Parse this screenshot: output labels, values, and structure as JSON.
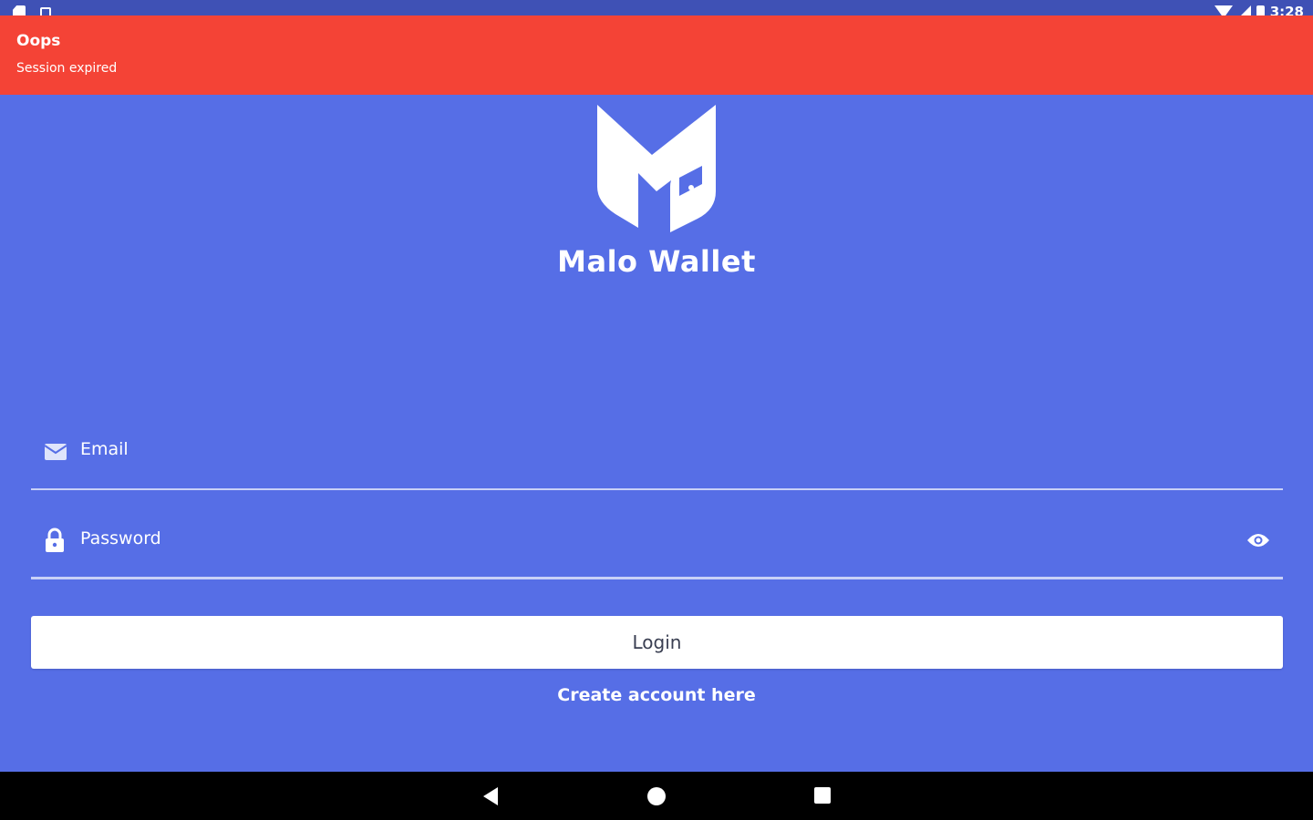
{
  "status_bar": {
    "time": "3:28",
    "left_icons": [
      "sd-card-icon",
      "notification-square-icon"
    ],
    "right_icons": [
      "wifi-icon",
      "cell-signal-icon",
      "battery-icon"
    ]
  },
  "snackbar": {
    "title": "Oops",
    "message": "Session expired",
    "color": "#f44336"
  },
  "brand": {
    "app_name": "Malo Wallet",
    "logo_icon": "malo-wallet-logo-icon",
    "background_color": "#566ee6"
  },
  "login_form": {
    "email_label": "Email",
    "email_icon": "envelope-icon",
    "password_label": "Password",
    "password_icon": "lock-icon",
    "visibility_icon": "eye-icon",
    "login_label": "Login",
    "create_account_label": "Create account here"
  },
  "nav_bar": {
    "icons": [
      "back-triangle-icon",
      "home-circle-icon",
      "recents-square-icon"
    ]
  }
}
